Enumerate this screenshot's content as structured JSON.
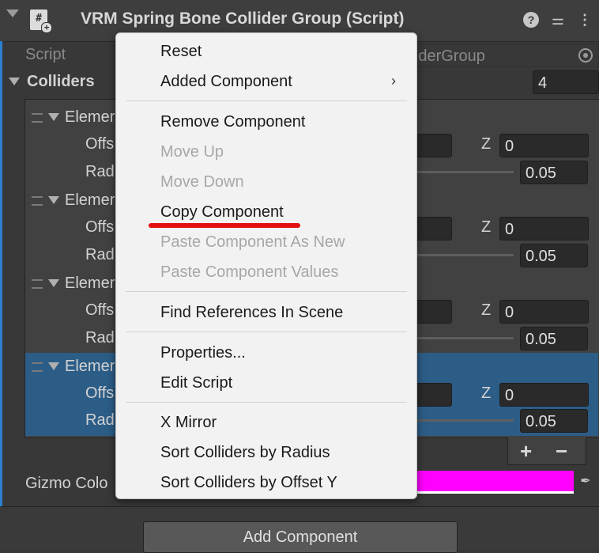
{
  "header": {
    "title": "VRM Spring Bone Collider Group (Script)",
    "script_icon_glyph": "#",
    "icons": [
      "fold-arrow-icon",
      "script-icon",
      "help-icon",
      "presets-icon",
      "kebab-icon"
    ]
  },
  "fields": {
    "script_label": "Script",
    "script_value": "lliderGroup",
    "colliders_label": "Colliders",
    "colliders_count": "4",
    "gizmo_label": "Gizmo Colo",
    "gizmo_color": "#ff00ff"
  },
  "elements": [
    {
      "label": "Elemer",
      "offset_label": "Offs",
      "radius_label": "Rad",
      "z_label": "Z",
      "z_value": "0",
      "radius_value": "0.05",
      "selected": false
    },
    {
      "label": "Elemer",
      "offset_label": "Offs",
      "radius_label": "Rad",
      "z_label": "Z",
      "z_value": "0",
      "radius_value": "0.05",
      "selected": false
    },
    {
      "label": "Elemer",
      "offset_label": "Offs",
      "radius_label": "Rad",
      "z_label": "Z",
      "z_value": "0",
      "radius_value": "0.05",
      "selected": false
    },
    {
      "label": "Elemer",
      "offset_label": "Offs",
      "radius_label": "Rad",
      "z_label": "Z",
      "z_value": "0",
      "radius_value": "0.05",
      "selected": true
    }
  ],
  "list_buttons": {
    "add": "+",
    "remove": "−"
  },
  "add_component_label": "Add Component",
  "menu": {
    "items": [
      {
        "label": "Reset",
        "enabled": true
      },
      {
        "label": "Added Component",
        "enabled": true,
        "submenu": true
      },
      {
        "label": "Remove Component",
        "enabled": true
      },
      {
        "label": "Move Up",
        "enabled": false
      },
      {
        "label": "Move Down",
        "enabled": false
      },
      {
        "label": "Copy Component",
        "enabled": true
      },
      {
        "label": "Paste Component As New",
        "enabled": false
      },
      {
        "label": "Paste Component Values",
        "enabled": false
      },
      {
        "label": "Find References In Scene",
        "enabled": true
      },
      {
        "label": "Properties...",
        "enabled": true
      },
      {
        "label": "Edit Script",
        "enabled": true
      },
      {
        "label": "X Mirror",
        "enabled": true
      },
      {
        "label": "Sort Colliders by Radius",
        "enabled": true
      },
      {
        "label": "Sort Colliders by Offset Y",
        "enabled": true
      }
    ],
    "submenu_arrow": "›",
    "annotation_color": "#e21010"
  }
}
